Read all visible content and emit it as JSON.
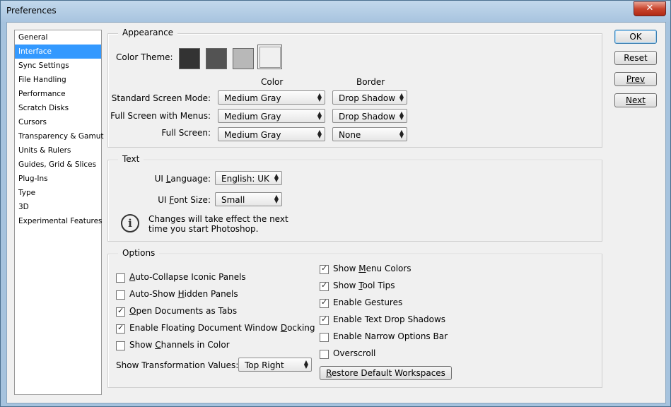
{
  "window": {
    "title": "Preferences",
    "close_glyph": "✕"
  },
  "sidebar": {
    "items": [
      {
        "label": "General"
      },
      {
        "label": "Interface",
        "selected": true
      },
      {
        "label": "Sync Settings"
      },
      {
        "label": "File Handling"
      },
      {
        "label": "Performance"
      },
      {
        "label": "Scratch Disks"
      },
      {
        "label": "Cursors"
      },
      {
        "label": "Transparency & Gamut"
      },
      {
        "label": "Units & Rulers"
      },
      {
        "label": "Guides, Grid & Slices"
      },
      {
        "label": "Plug-Ins"
      },
      {
        "label": "Type"
      },
      {
        "label": "3D"
      },
      {
        "label": "Experimental Features"
      }
    ]
  },
  "buttons": {
    "ok": "OK",
    "reset": "Reset",
    "prev": "Prev",
    "next": "Next"
  },
  "appearance": {
    "legend": "Appearance",
    "color_theme_label": "Color Theme:",
    "themes": [
      {
        "name": "darkest",
        "color": "#333333"
      },
      {
        "name": "dark",
        "color": "#535353"
      },
      {
        "name": "light",
        "color": "#b8b8b8"
      },
      {
        "name": "lightest",
        "color": "#f0f0f0",
        "selected": true
      }
    ],
    "col_color": "Color",
    "col_border": "Border",
    "rows": [
      {
        "label": "Standard Screen Mode:",
        "color": "Medium Gray",
        "border": "Drop Shadow"
      },
      {
        "label": "Full Screen with Menus:",
        "color": "Medium Gray",
        "border": "Drop Shadow"
      },
      {
        "label": "Full Screen:",
        "color": "Medium Gray",
        "border": "None"
      }
    ]
  },
  "text": {
    "legend": "Text",
    "ui_language_label_pre": "UI ",
    "ui_language_label_u": "L",
    "ui_language_label_post": "anguage:",
    "ui_language": "English: UK",
    "ui_font_size_label_pre": "UI ",
    "ui_font_size_label_u": "F",
    "ui_font_size_label_post": "ont Size:",
    "ui_font_size": "Small",
    "info_glyph": "i",
    "note_line1": "Changes will take effect the next",
    "note_line2": "time you start Photoshop."
  },
  "options": {
    "legend": "Options",
    "left": [
      {
        "pre": "",
        "u": "A",
        "post": "uto-Collapse Iconic Panels",
        "checked": false
      },
      {
        "pre": "Auto-Show ",
        "u": "H",
        "post": "idden Panels",
        "checked": false
      },
      {
        "pre": "",
        "u": "O",
        "post": "pen Documents as Tabs",
        "checked": true
      },
      {
        "pre": "Enable Floating Document Window ",
        "u": "D",
        "post": "ocking",
        "checked": true
      },
      {
        "pre": "Show ",
        "u": "C",
        "post": "hannels in Color",
        "checked": false
      }
    ],
    "right": [
      {
        "pre": "Show ",
        "u": "M",
        "post": "enu Colors",
        "checked": true
      },
      {
        "pre": "Show ",
        "u": "T",
        "post": "ool Tips",
        "checked": true
      },
      {
        "pre": "Enable Gestures",
        "u": "",
        "post": "",
        "checked": true
      },
      {
        "pre": "Enable Text Drop Shadows",
        "u": "",
        "post": "",
        "checked": true
      },
      {
        "pre": "Enable Narrow Options Bar",
        "u": "",
        "post": "",
        "checked": false
      },
      {
        "pre": "Overscroll",
        "u": "",
        "post": "",
        "checked": false
      }
    ],
    "transform_label": "Show Transformation Values:",
    "transform_value": "Top Right",
    "restore_pre": "",
    "restore_u": "R",
    "restore_post": "estore Default Workspaces",
    "check_glyph": "✓"
  },
  "dropdown_glyph_up": "▲",
  "dropdown_glyph_down": "▼"
}
